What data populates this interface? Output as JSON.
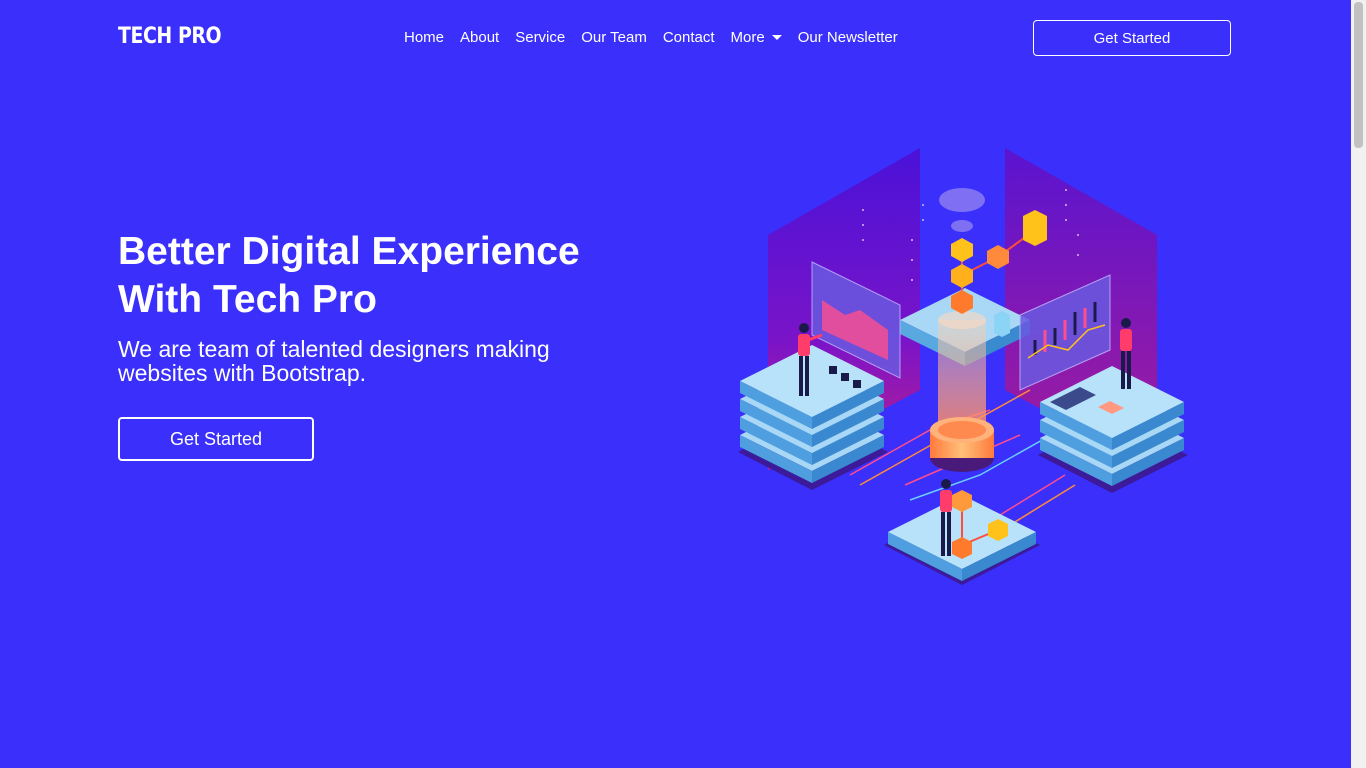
{
  "brand": "TECH PRO",
  "nav": {
    "items": [
      "Home",
      "About",
      "Service",
      "Our Team",
      "Contact"
    ],
    "more": "More",
    "newsletter": "Our Newsletter"
  },
  "header_cta": "Get Started",
  "hero": {
    "title_line1": "Better Digital Experience",
    "title_line2": "With Tech Pro",
    "subtitle": "We are team of talented designers making websites with Bootstrap.",
    "cta": "Get Started"
  },
  "colors": {
    "background": "#3a2ffb",
    "accent_orange": "#ff9a3c",
    "accent_yellow": "#ffc21a",
    "platform_blue": "#8cc8f0",
    "wall_purple": "#7a12c8"
  },
  "illustration_icon": "isometric-tech-illustration"
}
